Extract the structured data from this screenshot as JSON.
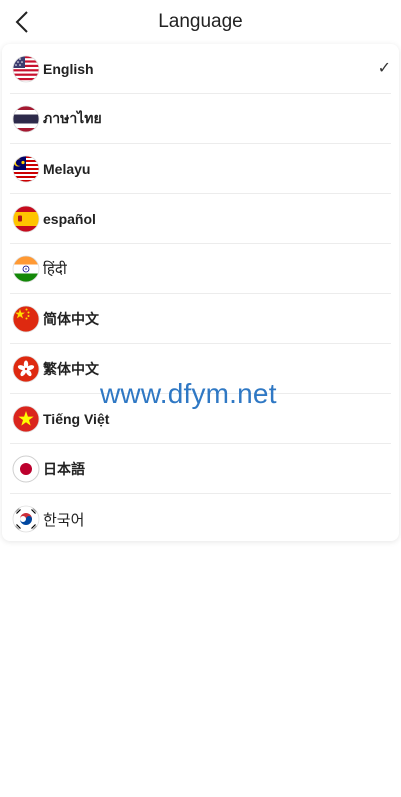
{
  "header": {
    "title": "Language"
  },
  "languages": [
    {
      "label": "English",
      "flag": "us-flag-icon",
      "selected": true
    },
    {
      "label": "ภาษาไทย",
      "flag": "thailand-flag-icon",
      "selected": false
    },
    {
      "label": "Melayu",
      "flag": "malaysia-flag-icon",
      "selected": false
    },
    {
      "label": "español",
      "flag": "spain-flag-icon",
      "selected": false
    },
    {
      "label": "हिंदी",
      "flag": "india-flag-icon",
      "selected": false
    },
    {
      "label": "简体中文",
      "flag": "china-flag-icon",
      "selected": false
    },
    {
      "label": "繁体中文",
      "flag": "hong-kong-flag-icon",
      "selected": false
    },
    {
      "label": "Tiếng Việt",
      "flag": "vietnam-flag-icon",
      "selected": false
    },
    {
      "label": "日本語",
      "flag": "japan-flag-icon",
      "selected": false
    },
    {
      "label": "한국어",
      "flag": "korea-flag-icon",
      "selected": false
    }
  ],
  "check_mark": "✓",
  "watermark": "www.dfym.net",
  "colors": {
    "accent_watermark": "#2f78c4",
    "divider": "#ececec"
  }
}
